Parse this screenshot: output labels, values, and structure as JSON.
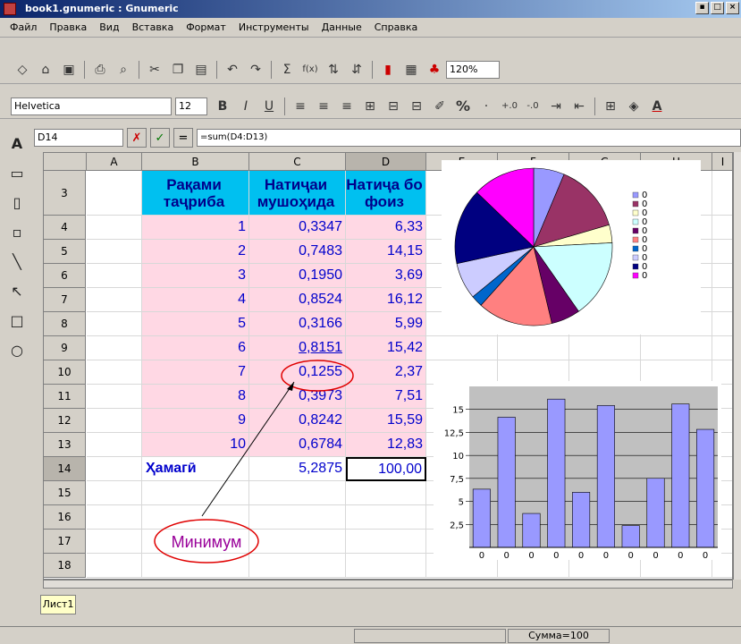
{
  "window": {
    "title": "book1.gnumeric : Gnumeric"
  },
  "menu": [
    "Файл",
    "Правка",
    "Вид",
    "Вставка",
    "Формат",
    "Инструменты",
    "Данные",
    "Справка"
  ],
  "toolbar": {
    "zoom": "120%",
    "font": "Helvetica",
    "font_size": "12",
    "percent": "%",
    "sum_icon": "Σ",
    "fx_icon": "f(x)"
  },
  "formula_bar": {
    "cell_ref": "D14",
    "formula": "=sum(D4:D13)"
  },
  "columns": [
    "A",
    "B",
    "C",
    "D",
    "E",
    "F",
    "G",
    "H",
    "I"
  ],
  "rows": [
    "3",
    "4",
    "5",
    "6",
    "7",
    "8",
    "9",
    "10",
    "11",
    "12",
    "13",
    "14",
    "15",
    "16",
    "17",
    "18"
  ],
  "headers": {
    "b": "Рақами таҷриба",
    "c": "Натиҷаи мушоҳида",
    "d": "Натиҷа бо фоиз"
  },
  "table": [
    {
      "b": "1",
      "c": "0,3347",
      "d": "6,33"
    },
    {
      "b": "2",
      "c": "0,7483",
      "d": "14,15"
    },
    {
      "b": "3",
      "c": "0,1950",
      "d": "3,69"
    },
    {
      "b": "4",
      "c": "0,8524",
      "d": "16,12"
    },
    {
      "b": "5",
      "c": "0,3166",
      "d": "5,99"
    },
    {
      "b": "6",
      "c": "0,8151",
      "d": "15,42"
    },
    {
      "b": "7",
      "c": "0,1255",
      "d": "2,37"
    },
    {
      "b": "8",
      "c": "0,3973",
      "d": "7,51"
    },
    {
      "b": "9",
      "c": "0,8242",
      "d": "15,59"
    },
    {
      "b": "10",
      "c": "0,6784",
      "d": "12,83"
    }
  ],
  "total": {
    "label": "Ҳамагӣ",
    "c": "5,2875",
    "d": "100,00"
  },
  "annotation": {
    "text": "Минимум"
  },
  "sheet_tab": "Лист1",
  "status": {
    "sum": "Сумма=100"
  },
  "chart_data": [
    {
      "type": "pie",
      "values": [
        6.33,
        14.15,
        3.69,
        16.12,
        5.99,
        15.42,
        2.37,
        7.51,
        15.59,
        12.83
      ],
      "colors": [
        "#9999ff",
        "#993366",
        "#ffffcc",
        "#ccffff",
        "#660066",
        "#ff8080",
        "#0066cc",
        "#ccccff",
        "#000080",
        "#ff00ff"
      ],
      "legend": [
        "0",
        "0",
        "0",
        "0",
        "0",
        "0",
        "0",
        "0",
        "0",
        "0"
      ],
      "legend_position": "right"
    },
    {
      "type": "bar",
      "categories": [
        "0",
        "0",
        "0",
        "0",
        "0",
        "0",
        "0",
        "0",
        "0",
        "0"
      ],
      "values": [
        6.33,
        14.15,
        3.69,
        16.12,
        5.99,
        15.42,
        2.37,
        7.51,
        15.59,
        12.83
      ],
      "yticks": [
        "2,5",
        "5",
        "7,5",
        "10",
        "12,5",
        "15"
      ],
      "ylim": [
        0,
        17.5
      ],
      "bar_color": "#9999ff",
      "grid": true
    }
  ]
}
